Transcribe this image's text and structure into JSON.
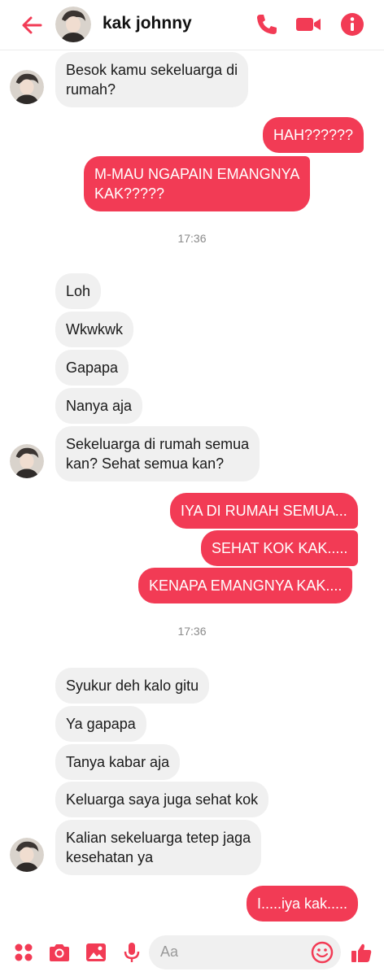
{
  "header": {
    "contact_name": "kak johnny",
    "accent_color": "#f23b55",
    "icons": [
      "back-arrow-icon",
      "contact-avatar",
      "phone-icon",
      "video-camera-icon",
      "info-icon"
    ]
  },
  "messages": [
    {
      "side": "in",
      "text": "Besok kamu sekeluarga di\nrumah?"
    },
    {
      "side": "out",
      "text": "HAH??????"
    },
    {
      "side": "out",
      "text": "M-MAU NGAPAIN EMANGNYA\nKAK?????"
    },
    {
      "type": "timestamp",
      "text": "17:36"
    },
    {
      "side": "in",
      "text": "Loh"
    },
    {
      "side": "in",
      "text": "Wkwkwk"
    },
    {
      "side": "in",
      "text": "Gapapa"
    },
    {
      "side": "in",
      "text": "Nanya aja"
    },
    {
      "side": "in",
      "text": "Sekeluarga di rumah semua\nkan? Sehat semua kan?"
    },
    {
      "side": "out",
      "text": "IYA DI RUMAH SEMUA..."
    },
    {
      "side": "out",
      "text": "SEHAT KOK KAK....."
    },
    {
      "side": "out",
      "text": "KENAPA EMANGNYA KAK...."
    },
    {
      "type": "timestamp",
      "text": "17:36"
    },
    {
      "side": "in",
      "text": "Syukur deh kalo gitu"
    },
    {
      "side": "in",
      "text": "Ya gapapa"
    },
    {
      "side": "in",
      "text": "Tanya kabar aja"
    },
    {
      "side": "in",
      "text": "Keluarga saya juga sehat kok"
    },
    {
      "side": "in",
      "text": "Kalian sekeluarga tetep jaga\nkesehatan ya"
    },
    {
      "side": "out",
      "text": "I.....iya kak....."
    }
  ],
  "composer": {
    "placeholder": "Aa",
    "icons": [
      "apps-grid-icon",
      "camera-icon",
      "image-icon",
      "microphone-icon",
      "emoji-icon",
      "thumbs-up-icon"
    ]
  }
}
